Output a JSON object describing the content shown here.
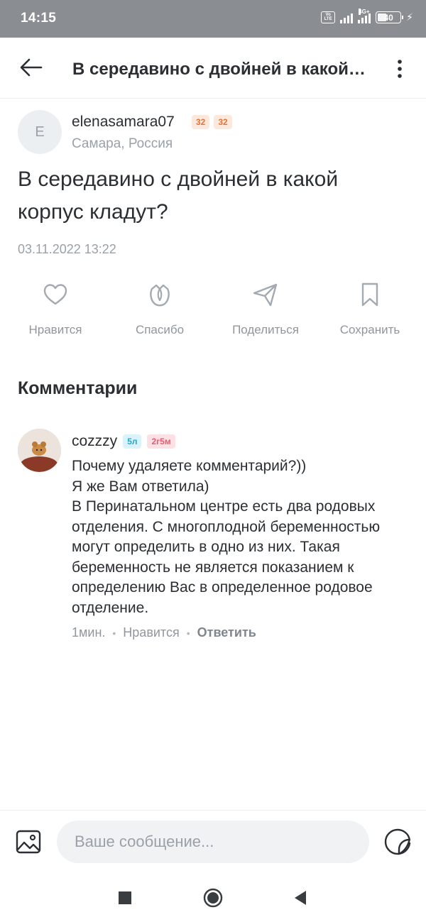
{
  "status_bar": {
    "time": "14:15",
    "volte": "Vo LTE",
    "network": "4G+",
    "battery": "40",
    "charging_icon": "⚡"
  },
  "header": {
    "title": "В середавино с двойней в какой корпус кладут?"
  },
  "post": {
    "author": {
      "avatar_letter": "E",
      "name": "elenasamara07",
      "badges": [
        "32",
        "32"
      ],
      "location": "Самара, Россия"
    },
    "question": "В середавино с двойней в какой корпус кладут?",
    "date": "03.11.2022 13:22"
  },
  "actions": {
    "like": "Нравится",
    "thanks": "Спасибо",
    "share": "Поделиться",
    "save": "Сохранить"
  },
  "comments": {
    "title": "Комментарии",
    "items": [
      {
        "author": "cozzzy",
        "badges": [
          "5л",
          "2г5м"
        ],
        "lines": [
          "Почему удаляете комментарий?))",
          "Я же Вам ответила)",
          "В Перинатальном центре есть два родовых отделения. С многоплодной беременностью могут определить в одно из них. Такая беременность не является показанием к определению Вас в определенное родовое отделение."
        ],
        "time": "1мин.",
        "like": "Нравится",
        "reply": "Ответить"
      }
    ]
  },
  "composer": {
    "placeholder": "Ваше сообщение..."
  },
  "colors": {
    "status_bar": "#8a8d91",
    "text": "#2b2f33",
    "muted": "#9aa1a8",
    "badge_orange": "#e2733b",
    "badge_blue": "#2aa6c9",
    "badge_pink": "#e85a72"
  },
  "icons": {
    "back": "arrow-left-icon",
    "more": "more-vertical-icon",
    "like": "heart-icon",
    "thanks": "flower-icon",
    "share": "send-icon",
    "save": "bookmark-icon",
    "image": "image-icon",
    "sticker": "sticker-icon",
    "nav_recents": "square-icon",
    "nav_home": "circle-icon",
    "nav_back": "triangle-back-icon"
  }
}
